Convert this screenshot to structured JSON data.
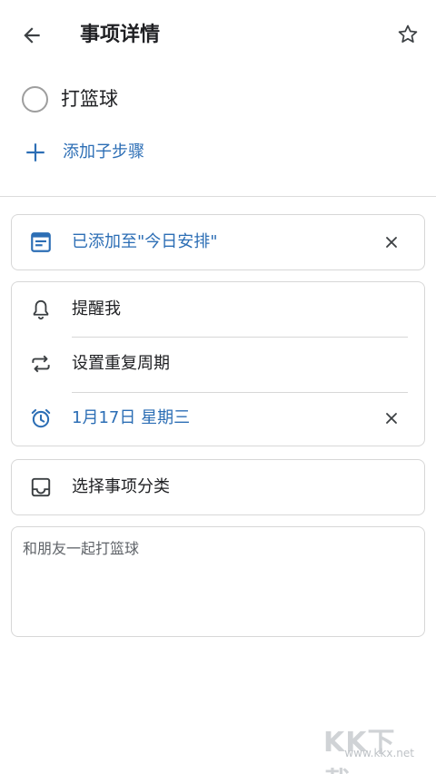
{
  "header": {
    "title": "事项详情",
    "back_icon": "arrow-left-icon",
    "star_icon": "star-outline-icon"
  },
  "task": {
    "title": "打篮球",
    "completed": false
  },
  "add_step": {
    "label": "添加子步骤"
  },
  "today_card": {
    "label": "已添加至\"今日安排\"",
    "icon": "calendar-note-icon"
  },
  "schedule_card": {
    "reminder_label": "提醒我",
    "repeat_label": "设置重复周期",
    "due_label": "1月17日 星期三"
  },
  "category_card": {
    "label": "选择事项分类"
  },
  "note": {
    "text": "和朋友一起打篮球"
  },
  "watermark": {
    "logo": "KK下载",
    "url": "www.kkx.net"
  },
  "colors": {
    "accent": "#2c6eb5",
    "text": "#202124",
    "border": "#d7d7d7"
  }
}
